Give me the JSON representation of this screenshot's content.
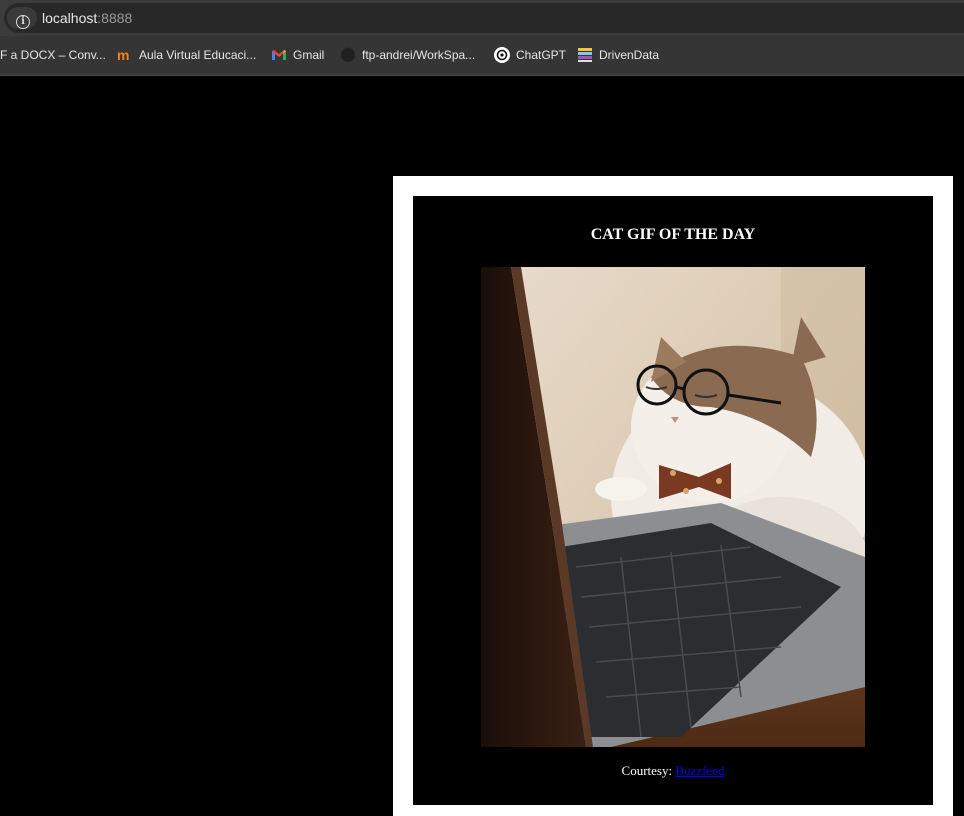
{
  "browser": {
    "url_host": "localhost",
    "url_port": ":8888",
    "bookmarks": [
      {
        "label": "F a DOCX – Conv...",
        "icon": "document-icon"
      },
      {
        "label": "Aula Virtual Educaci...",
        "icon": "moodle-icon"
      },
      {
        "label": "Gmail",
        "icon": "gmail-icon"
      },
      {
        "label": "ftp-andrei/WorkSpa...",
        "icon": "github-icon"
      },
      {
        "label": "ChatGPT",
        "icon": "chatgpt-icon"
      },
      {
        "label": "DrivenData",
        "icon": "drivendata-icon"
      }
    ]
  },
  "page": {
    "title": "CAT GIF OF THE DAY",
    "image_alt": "cat with glasses at laptop",
    "courtesy_prefix": "Courtesy: ",
    "courtesy_link": "Buzzfeed"
  }
}
